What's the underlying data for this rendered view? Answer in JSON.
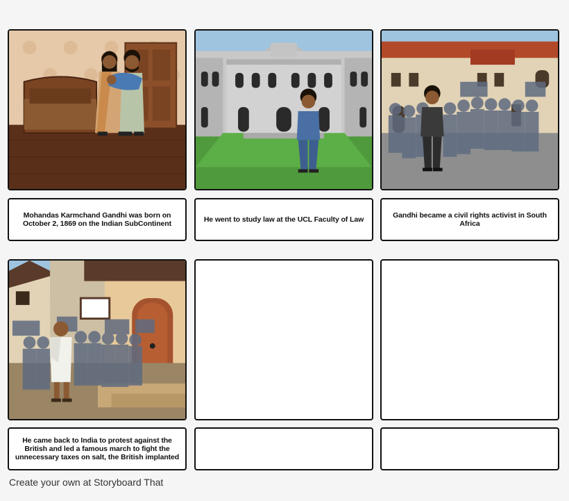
{
  "panels": [
    {
      "caption": "Mohandas Karmchand Gandhi was born on October 2, 1869 on the Indian  SubContinent"
    },
    {
      "caption": "He went to study law at the UCL Faculty of Law"
    },
    {
      "caption": "Gandhi became a civil rights activist in South Africa"
    },
    {
      "caption": "He came back to India to protest against the British and led a famous march to fight the unnecessary taxes on salt, the British implanted"
    },
    {
      "caption": ""
    },
    {
      "caption": ""
    }
  ],
  "footer": {
    "text": "Create your own at Storyboard That"
  }
}
